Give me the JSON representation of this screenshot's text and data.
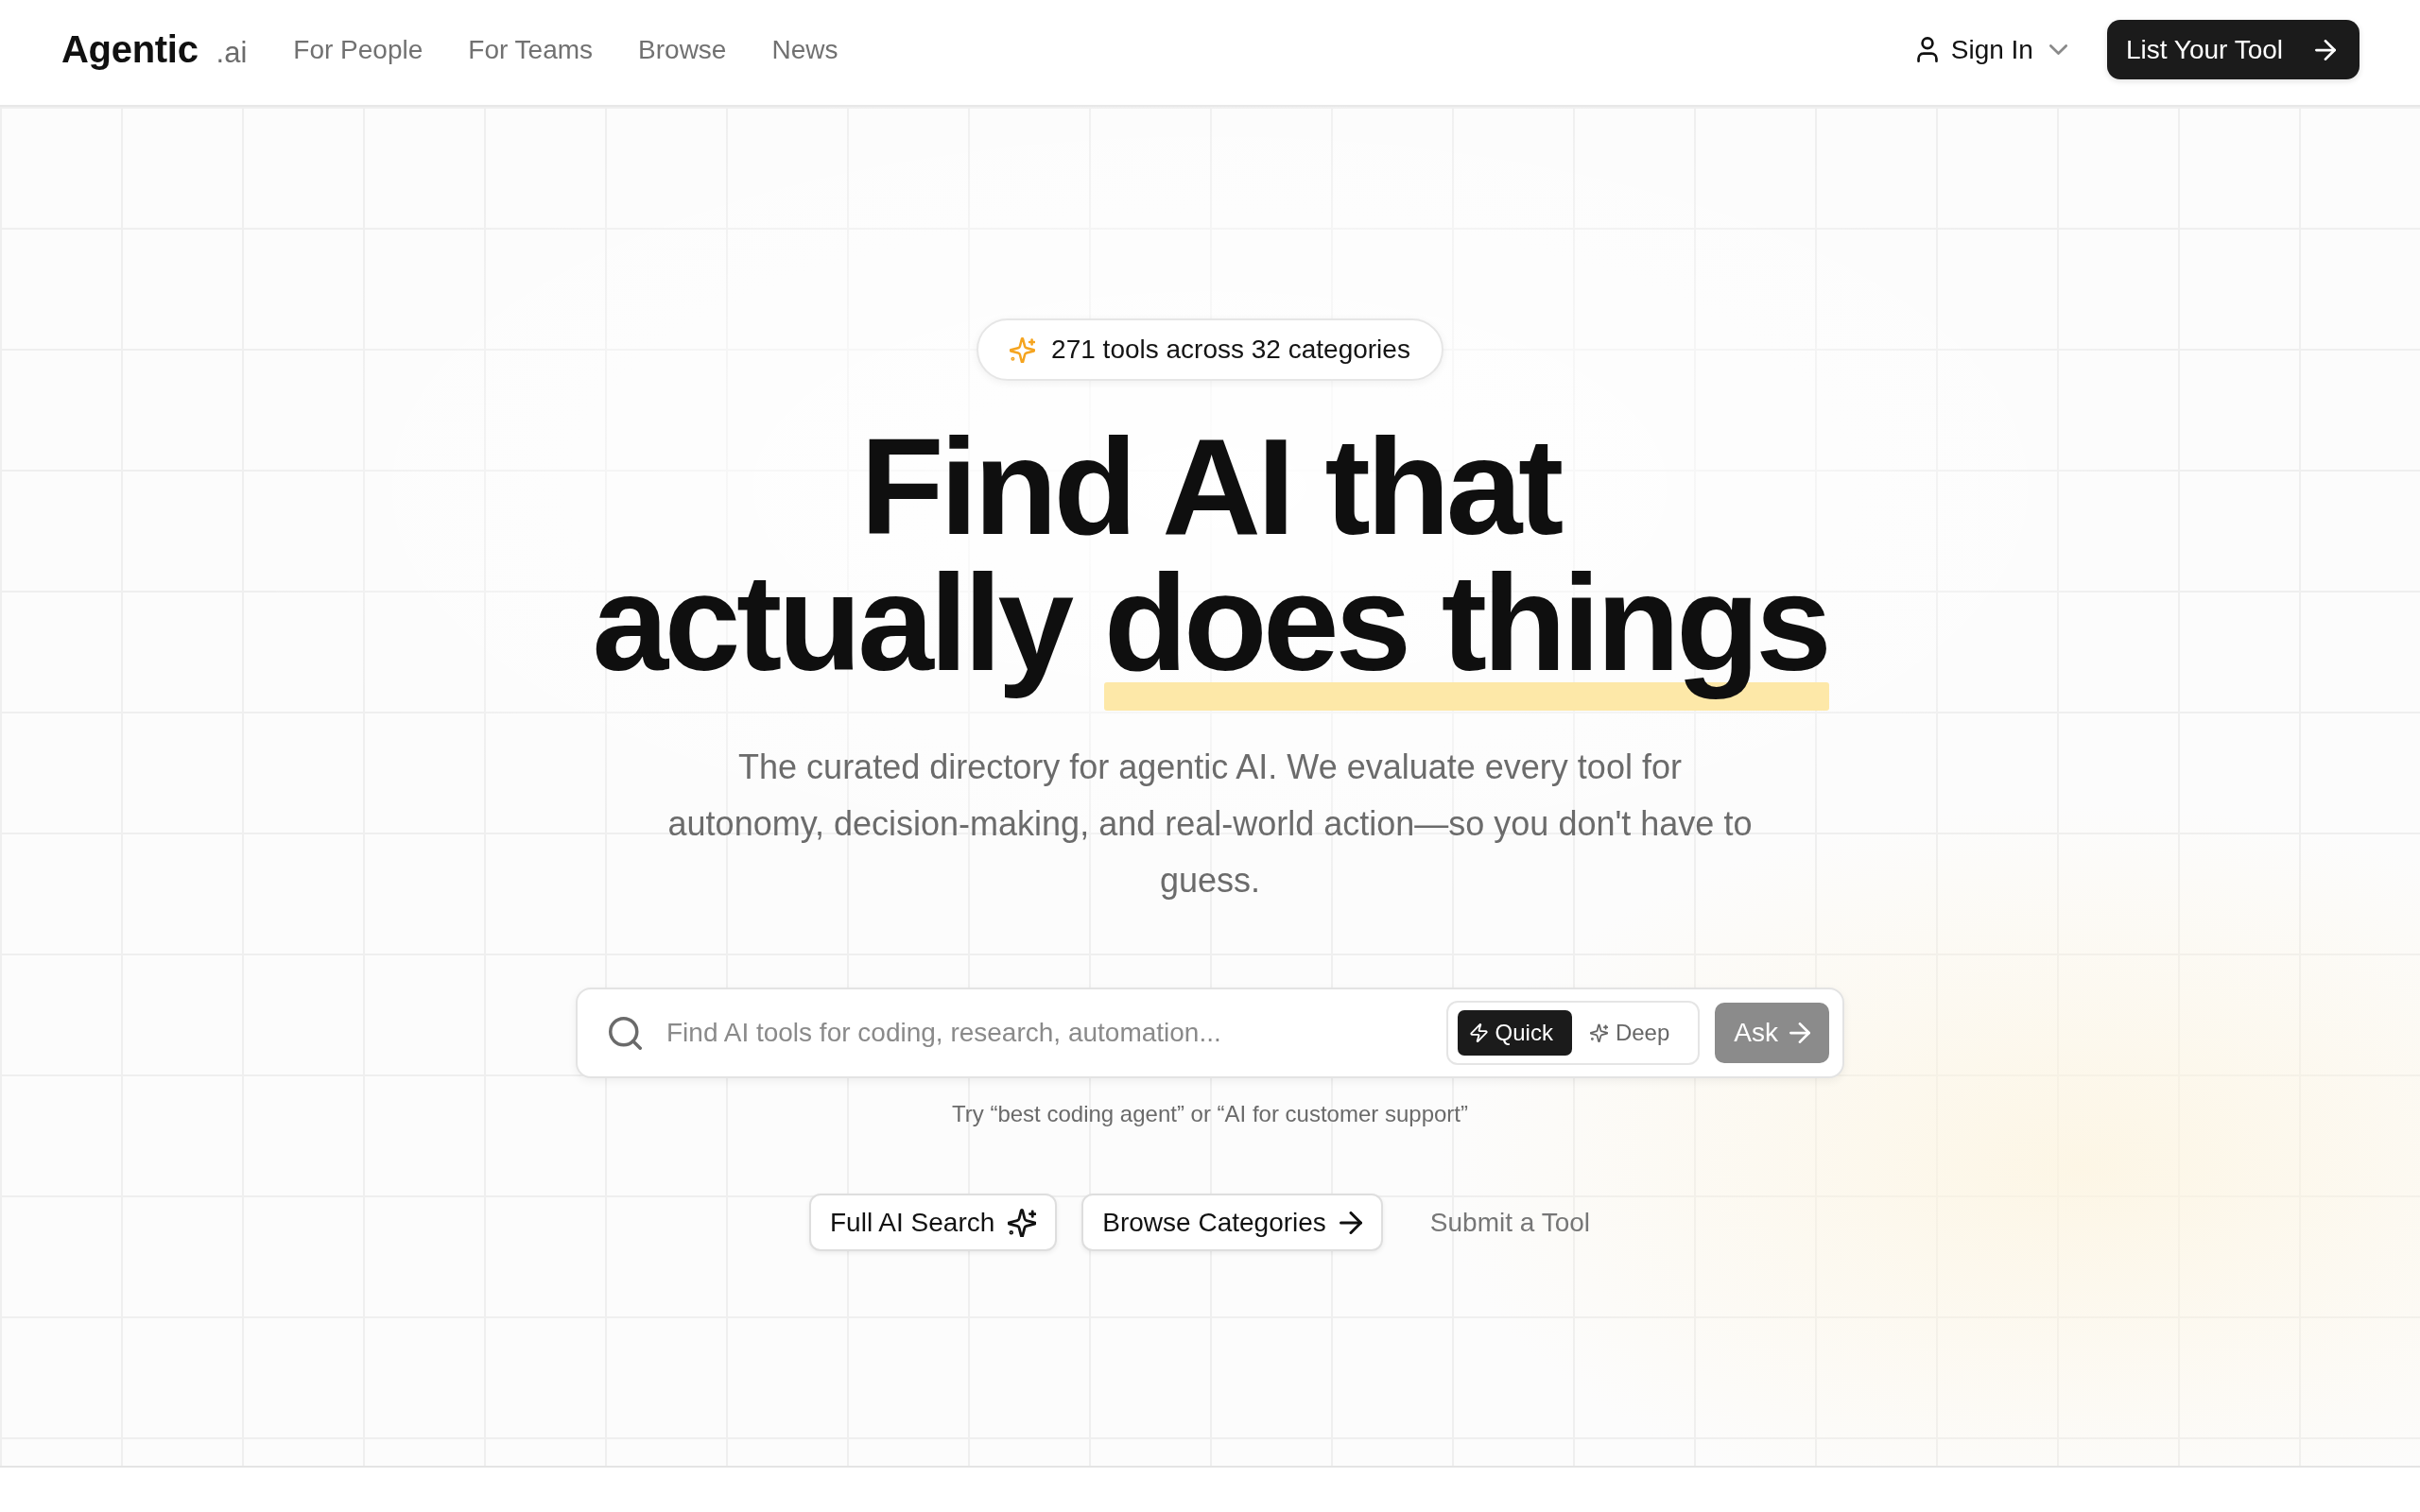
{
  "header": {
    "logo": "Agentic",
    "logo_suffix": ".ai",
    "nav": [
      "For People",
      "For Teams",
      "Browse",
      "News"
    ],
    "sign_in": "Sign In",
    "cta": "List Your Tool"
  },
  "hero": {
    "badge": "271 tools across 32 categories",
    "headline": [
      [
        {
          "text": "Find AI that",
          "highlighted": false
        }
      ],
      [
        {
          "text": "actually",
          "highlighted": false
        },
        {
          "text": "does things",
          "highlighted": true
        }
      ]
    ],
    "subtitle": "The curated directory for agentic AI. We evaluate every tool for autonomy, decision-making, and real-world action—so you don't have to guess.",
    "search": {
      "placeholder": "Find AI tools for coding, research, automation...",
      "modes": [
        {
          "label": "Quick",
          "selected": true
        },
        {
          "label": "Deep",
          "selected": false
        }
      ],
      "submit": {
        "label": "Ask",
        "disabled": true
      }
    },
    "hint": "Try “best coding agent” or “AI for customer support”",
    "actions": [
      {
        "label": "Full AI Search",
        "kind": "outlined"
      },
      {
        "label": "Browse Categories",
        "kind": "outlined"
      },
      {
        "label": "Submit a Tool",
        "kind": "link"
      }
    ]
  }
}
